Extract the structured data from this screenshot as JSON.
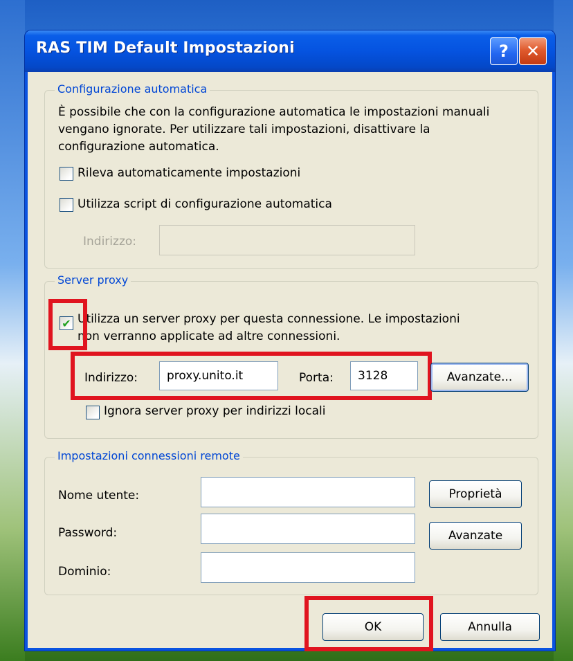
{
  "window": {
    "title": "RAS TIM Default Impostazioni",
    "help_label": "?",
    "close_label": "✕"
  },
  "auto_config": {
    "group_label": "Configurazione automatica",
    "description_line1": "È possibile che con la configurazione automatica le impostazioni manuali",
    "description_line2": "vengano ignorate. Per utilizzare tali impostazioni, disattivare la",
    "description_line3": "configurazione automatica.",
    "detect_label": "Rileva automaticamente impostazioni",
    "detect_checked": false,
    "script_label": "Utilizza script di configurazione automatica",
    "script_checked": false,
    "address_label": "Indirizzo:",
    "address_value": ""
  },
  "proxy": {
    "group_label": "Server proxy",
    "use_proxy_line1": "Utilizza un server proxy per questa connessione. Le impostazioni",
    "use_proxy_line2": "non verranno applicate ad altre connessioni.",
    "use_proxy_checked": true,
    "check_mark": "✔",
    "address_label": "Indirizzo:",
    "address_value": "proxy.unito.it",
    "port_label": "Porta:",
    "port_value": "3128",
    "advanced_label": "Avanzate...",
    "bypass_label": "Ignora server proxy per indirizzi locali",
    "bypass_checked": false
  },
  "remote": {
    "group_label": "Impostazioni connessioni remote",
    "username_label": "Nome utente:",
    "username_value": "",
    "password_label": "Password:",
    "password_value": "",
    "domain_label": "Dominio:",
    "domain_value": "",
    "properties_label": "Proprietà",
    "advanced_label": "Avanzate"
  },
  "footer": {
    "ok_label": "OK",
    "cancel_label": "Annulla"
  },
  "colors": {
    "highlight": "#e0141f",
    "group_label": "#0046d5",
    "dialog_bg": "#ece9d8",
    "titlebar": "#0553e0"
  }
}
